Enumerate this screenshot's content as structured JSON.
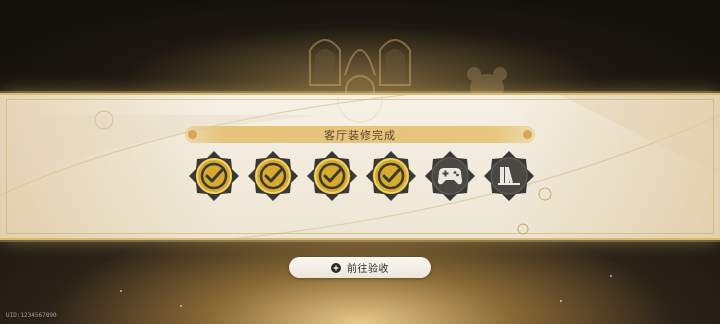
{
  "panel": {
    "title": "客厅装修完成"
  },
  "badges": [
    {
      "icon": "check-icon",
      "state": "completed"
    },
    {
      "icon": "check-icon",
      "state": "completed"
    },
    {
      "icon": "check-icon",
      "state": "completed"
    },
    {
      "icon": "check-icon",
      "state": "completed"
    },
    {
      "icon": "gamepad-icon",
      "state": "locked"
    },
    {
      "icon": "books-icon",
      "state": "locked"
    }
  ],
  "action": {
    "label": "前往验收",
    "icon": "plus-circle-icon"
  },
  "footer": {
    "uid": "UID:1234567890"
  },
  "colors": {
    "gold": "#d9b96a",
    "badge_dark": "#3a3835",
    "check_gold": "#e8c03a"
  }
}
